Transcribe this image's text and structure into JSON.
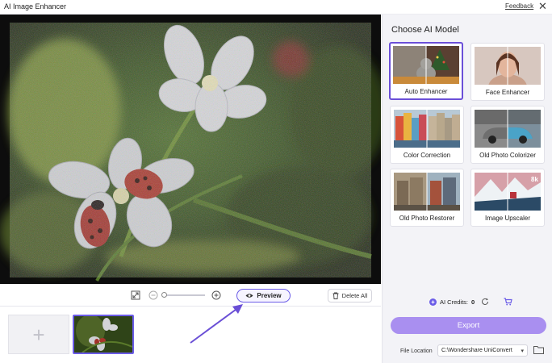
{
  "window": {
    "title": "AI Image Enhancer",
    "feedback_label": "Feedback",
    "close_glyph": "✕"
  },
  "toolbar": {
    "preview_label": "Preview",
    "delete_all_label": "Delete All",
    "zoom_level_fraction": 0.0,
    "icons": [
      "fit-screen-icon",
      "zoom-out-icon",
      "zoom-in-icon",
      "eye-icon",
      "trash-icon"
    ]
  },
  "thumbnails": {
    "add_glyph": "+",
    "selected_index": 0
  },
  "panel": {
    "title": "Choose AI Model",
    "models": [
      {
        "label": "Auto Enhancer",
        "selected": true
      },
      {
        "label": "Face Enhancer",
        "selected": false
      },
      {
        "label": "Color Correction",
        "selected": false
      },
      {
        "label": "Old Photo Colorizer",
        "selected": false
      },
      {
        "label": "Old Photo Restorer",
        "selected": false
      },
      {
        "label": "Image Upscaler",
        "selected": false
      }
    ],
    "upscaler_badge": "8k",
    "credits_label": "AI Credits:",
    "credits_value": "0",
    "export_label": "Export",
    "file_location_label": "File Location",
    "file_location_value": "C:\\Wondershare UniConvert"
  },
  "colors": {
    "accent": "#6b5ce7",
    "export_button": "#a98ff0",
    "selected_border": "#6b4fd8",
    "arrow": "#6a4fd6"
  }
}
